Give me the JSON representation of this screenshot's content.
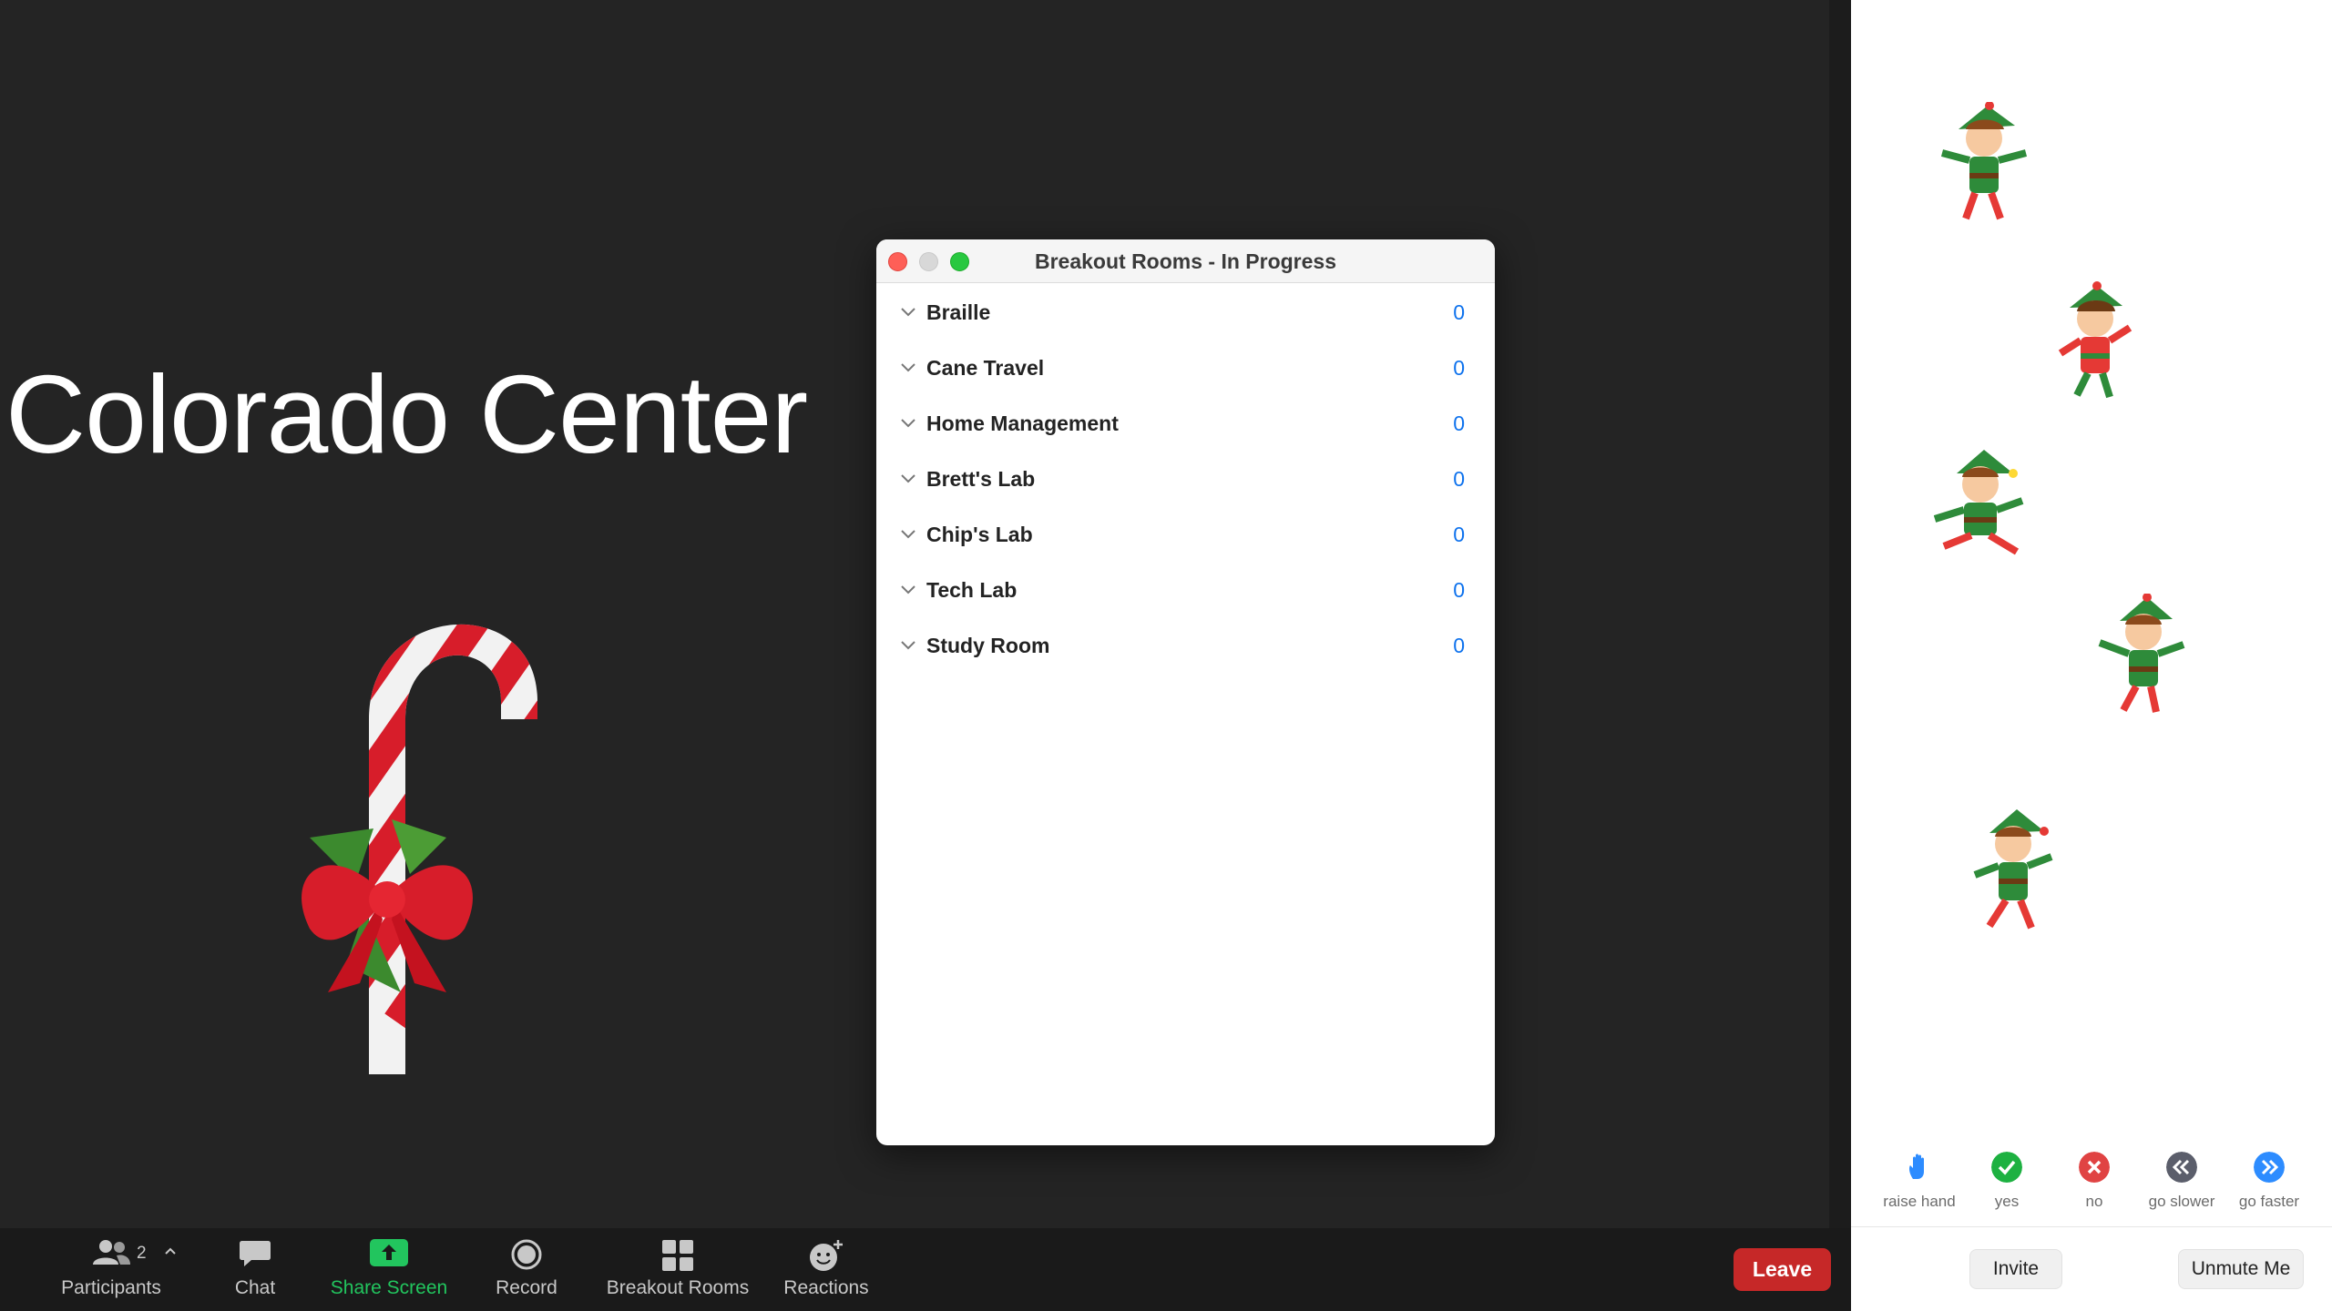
{
  "share": {
    "title": "Colorado Center"
  },
  "breakout_window": {
    "title": "Breakout Rooms - In Progress",
    "rooms": [
      {
        "name": "Braille",
        "count": "0"
      },
      {
        "name": "Cane Travel",
        "count": "0"
      },
      {
        "name": "Home Management",
        "count": "0"
      },
      {
        "name": "Brett's Lab",
        "count": "0"
      },
      {
        "name": "Chip's Lab",
        "count": "0"
      },
      {
        "name": "Tech Lab",
        "count": "0"
      },
      {
        "name": "Study Room",
        "count": "0"
      }
    ]
  },
  "toolbar": {
    "participants_label": "Participants",
    "participants_count": "2",
    "chat_label": "Chat",
    "share_label": "Share Screen",
    "record_label": "Record",
    "breakout_label": "Breakout Rooms",
    "reactions_label": "Reactions",
    "leave_label": "Leave"
  },
  "feedback": {
    "raise_hand": "raise hand",
    "yes": "yes",
    "no": "no",
    "go_slower": "go slower",
    "go_faster": "go faster"
  },
  "right_panel": {
    "invite_label": "Invite",
    "unmute_label": "Unmute Me"
  },
  "colors": {
    "leave": "#c62828",
    "share_green": "#22c55e",
    "link_blue": "#0e72ed",
    "yes_green": "#1db141",
    "no_red": "#e04343",
    "slower_gray": "#5b5e6b",
    "faster_blue": "#2d8cff"
  }
}
